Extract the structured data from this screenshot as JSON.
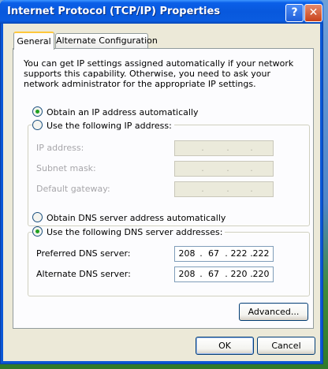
{
  "window": {
    "title": "Internet Protocol (TCP/IP) Properties",
    "help_glyph": "?",
    "close_glyph": "✕"
  },
  "tabs": [
    {
      "label": "General",
      "selected": true
    },
    {
      "label": "Alternate Configuration",
      "selected": false
    }
  ],
  "description": "You can get IP settings assigned automatically if your network supports this capability. Otherwise, you need to ask your network administrator for the appropriate IP settings.",
  "ip": {
    "auto_label": "Obtain an IP address automatically",
    "auto_selected": true,
    "manual_label": "Use the following IP address:",
    "manual_selected": false,
    "fields": [
      {
        "label": "IP address:",
        "octets": [
          "",
          "",
          "",
          ""
        ]
      },
      {
        "label": "Subnet mask:",
        "octets": [
          "",
          "",
          "",
          ""
        ]
      },
      {
        "label": "Default gateway:",
        "octets": [
          "",
          "",
          "",
          ""
        ]
      }
    ]
  },
  "dns": {
    "auto_label": "Obtain DNS server address automatically",
    "auto_selected": false,
    "manual_label": "Use the following DNS server addresses:",
    "manual_selected": true,
    "preferred_label": "Preferred DNS server:",
    "preferred_octets": [
      "208",
      "67",
      "222",
      "222"
    ],
    "alternate_label": "Alternate DNS server:",
    "alternate_octets": [
      "208",
      "67",
      "220",
      "220"
    ]
  },
  "buttons": {
    "advanced": "Advanced...",
    "ok": "OK",
    "cancel": "Cancel"
  },
  "colors": {
    "titlebar": "#0858dd",
    "face": "#ece9d8",
    "selected_radio": "#21a121"
  }
}
